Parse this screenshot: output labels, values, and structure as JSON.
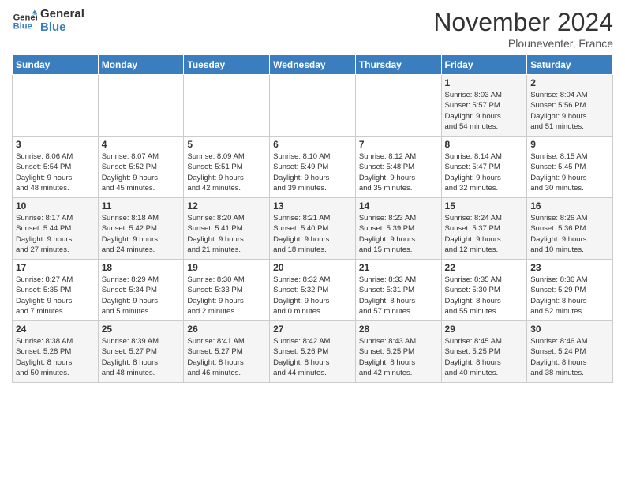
{
  "logo": {
    "line1": "General",
    "line2": "Blue"
  },
  "title": "November 2024",
  "location": "Plouneventer, France",
  "days_of_week": [
    "Sunday",
    "Monday",
    "Tuesday",
    "Wednesday",
    "Thursday",
    "Friday",
    "Saturday"
  ],
  "weeks": [
    [
      {
        "day": "",
        "info": ""
      },
      {
        "day": "",
        "info": ""
      },
      {
        "day": "",
        "info": ""
      },
      {
        "day": "",
        "info": ""
      },
      {
        "day": "",
        "info": ""
      },
      {
        "day": "1",
        "info": "Sunrise: 8:03 AM\nSunset: 5:57 PM\nDaylight: 9 hours\nand 54 minutes."
      },
      {
        "day": "2",
        "info": "Sunrise: 8:04 AM\nSunset: 5:56 PM\nDaylight: 9 hours\nand 51 minutes."
      }
    ],
    [
      {
        "day": "3",
        "info": "Sunrise: 8:06 AM\nSunset: 5:54 PM\nDaylight: 9 hours\nand 48 minutes."
      },
      {
        "day": "4",
        "info": "Sunrise: 8:07 AM\nSunset: 5:52 PM\nDaylight: 9 hours\nand 45 minutes."
      },
      {
        "day": "5",
        "info": "Sunrise: 8:09 AM\nSunset: 5:51 PM\nDaylight: 9 hours\nand 42 minutes."
      },
      {
        "day": "6",
        "info": "Sunrise: 8:10 AM\nSunset: 5:49 PM\nDaylight: 9 hours\nand 39 minutes."
      },
      {
        "day": "7",
        "info": "Sunrise: 8:12 AM\nSunset: 5:48 PM\nDaylight: 9 hours\nand 35 minutes."
      },
      {
        "day": "8",
        "info": "Sunrise: 8:14 AM\nSunset: 5:47 PM\nDaylight: 9 hours\nand 32 minutes."
      },
      {
        "day": "9",
        "info": "Sunrise: 8:15 AM\nSunset: 5:45 PM\nDaylight: 9 hours\nand 30 minutes."
      }
    ],
    [
      {
        "day": "10",
        "info": "Sunrise: 8:17 AM\nSunset: 5:44 PM\nDaylight: 9 hours\nand 27 minutes."
      },
      {
        "day": "11",
        "info": "Sunrise: 8:18 AM\nSunset: 5:42 PM\nDaylight: 9 hours\nand 24 minutes."
      },
      {
        "day": "12",
        "info": "Sunrise: 8:20 AM\nSunset: 5:41 PM\nDaylight: 9 hours\nand 21 minutes."
      },
      {
        "day": "13",
        "info": "Sunrise: 8:21 AM\nSunset: 5:40 PM\nDaylight: 9 hours\nand 18 minutes."
      },
      {
        "day": "14",
        "info": "Sunrise: 8:23 AM\nSunset: 5:39 PM\nDaylight: 9 hours\nand 15 minutes."
      },
      {
        "day": "15",
        "info": "Sunrise: 8:24 AM\nSunset: 5:37 PM\nDaylight: 9 hours\nand 12 minutes."
      },
      {
        "day": "16",
        "info": "Sunrise: 8:26 AM\nSunset: 5:36 PM\nDaylight: 9 hours\nand 10 minutes."
      }
    ],
    [
      {
        "day": "17",
        "info": "Sunrise: 8:27 AM\nSunset: 5:35 PM\nDaylight: 9 hours\nand 7 minutes."
      },
      {
        "day": "18",
        "info": "Sunrise: 8:29 AM\nSunset: 5:34 PM\nDaylight: 9 hours\nand 5 minutes."
      },
      {
        "day": "19",
        "info": "Sunrise: 8:30 AM\nSunset: 5:33 PM\nDaylight: 9 hours\nand 2 minutes."
      },
      {
        "day": "20",
        "info": "Sunrise: 8:32 AM\nSunset: 5:32 PM\nDaylight: 9 hours\nand 0 minutes."
      },
      {
        "day": "21",
        "info": "Sunrise: 8:33 AM\nSunset: 5:31 PM\nDaylight: 8 hours\nand 57 minutes."
      },
      {
        "day": "22",
        "info": "Sunrise: 8:35 AM\nSunset: 5:30 PM\nDaylight: 8 hours\nand 55 minutes."
      },
      {
        "day": "23",
        "info": "Sunrise: 8:36 AM\nSunset: 5:29 PM\nDaylight: 8 hours\nand 52 minutes."
      }
    ],
    [
      {
        "day": "24",
        "info": "Sunrise: 8:38 AM\nSunset: 5:28 PM\nDaylight: 8 hours\nand 50 minutes."
      },
      {
        "day": "25",
        "info": "Sunrise: 8:39 AM\nSunset: 5:27 PM\nDaylight: 8 hours\nand 48 minutes."
      },
      {
        "day": "26",
        "info": "Sunrise: 8:41 AM\nSunset: 5:27 PM\nDaylight: 8 hours\nand 46 minutes."
      },
      {
        "day": "27",
        "info": "Sunrise: 8:42 AM\nSunset: 5:26 PM\nDaylight: 8 hours\nand 44 minutes."
      },
      {
        "day": "28",
        "info": "Sunrise: 8:43 AM\nSunset: 5:25 PM\nDaylight: 8 hours\nand 42 minutes."
      },
      {
        "day": "29",
        "info": "Sunrise: 8:45 AM\nSunset: 5:25 PM\nDaylight: 8 hours\nand 40 minutes."
      },
      {
        "day": "30",
        "info": "Sunrise: 8:46 AM\nSunset: 5:24 PM\nDaylight: 8 hours\nand 38 minutes."
      }
    ]
  ],
  "colors": {
    "header_bg": "#3a7ebf",
    "header_text": "#ffffff",
    "row_odd": "#f5f5f5",
    "row_even": "#ffffff"
  }
}
